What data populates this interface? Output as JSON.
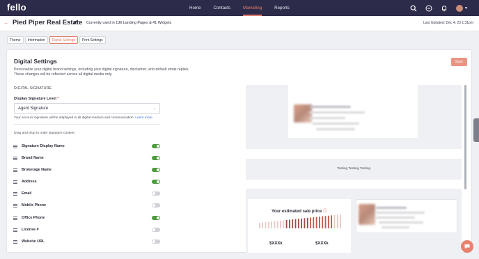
{
  "app": {
    "logo": "fello"
  },
  "nav": {
    "links": [
      "Home",
      "Contacts",
      "Marketing",
      "Reports"
    ],
    "active": "Marketing",
    "accent": "#e0806f"
  },
  "header": {
    "title": "Pied Piper Real Estate",
    "usage": "Currently used in 136 Landing Pages & 41 Widgets",
    "last_updated": "Last Updated: Dec 4, 23 1:31pm"
  },
  "tabs": [
    "Theme",
    "Information",
    "Digital Settings",
    "Print Settings"
  ],
  "settings": {
    "title": "Digital Settings",
    "description_line1": "Personalize your digital brand settings, including your digital signature, disclaimer, and default email replies.",
    "description_line2": "These changes will be reflected across all digital media only.",
    "save_label": "Save",
    "section_heading": "DIGITAL SIGNATURE",
    "signature_level_label": "Display Signature Level",
    "required_mark": "*",
    "signature_level_value": "Agent Signature",
    "hint": "Your account signature will be displayed in all digital medium and communication.",
    "learn_more": "Learn more",
    "drag_hint": "Drag and drop to order signature content."
  },
  "signature_fields": [
    {
      "label": "Signature Display Name",
      "enabled": true
    },
    {
      "label": "Brand Name",
      "enabled": true
    },
    {
      "label": "Brokerage Name",
      "enabled": true
    },
    {
      "label": "Address",
      "enabled": true
    },
    {
      "label": "Email",
      "enabled": false
    },
    {
      "label": "Mobile Phone",
      "enabled": false
    },
    {
      "label": "Office Phone",
      "enabled": true
    },
    {
      "label": "License #",
      "enabled": false
    },
    {
      "label": "Website URL",
      "enabled": false
    }
  ],
  "preview": {
    "disclaimer_text": "Testing Testing Testing",
    "estimate_title": "Your estimated sale price",
    "estimate_low": "$XXXk",
    "estimate_high": "$XXXk"
  },
  "colors": {
    "toggle_on": "#4e9a3f",
    "toggle_off": "#cfd1d6",
    "save": "#ea9484",
    "nav_bg": "#2d2b4a"
  }
}
